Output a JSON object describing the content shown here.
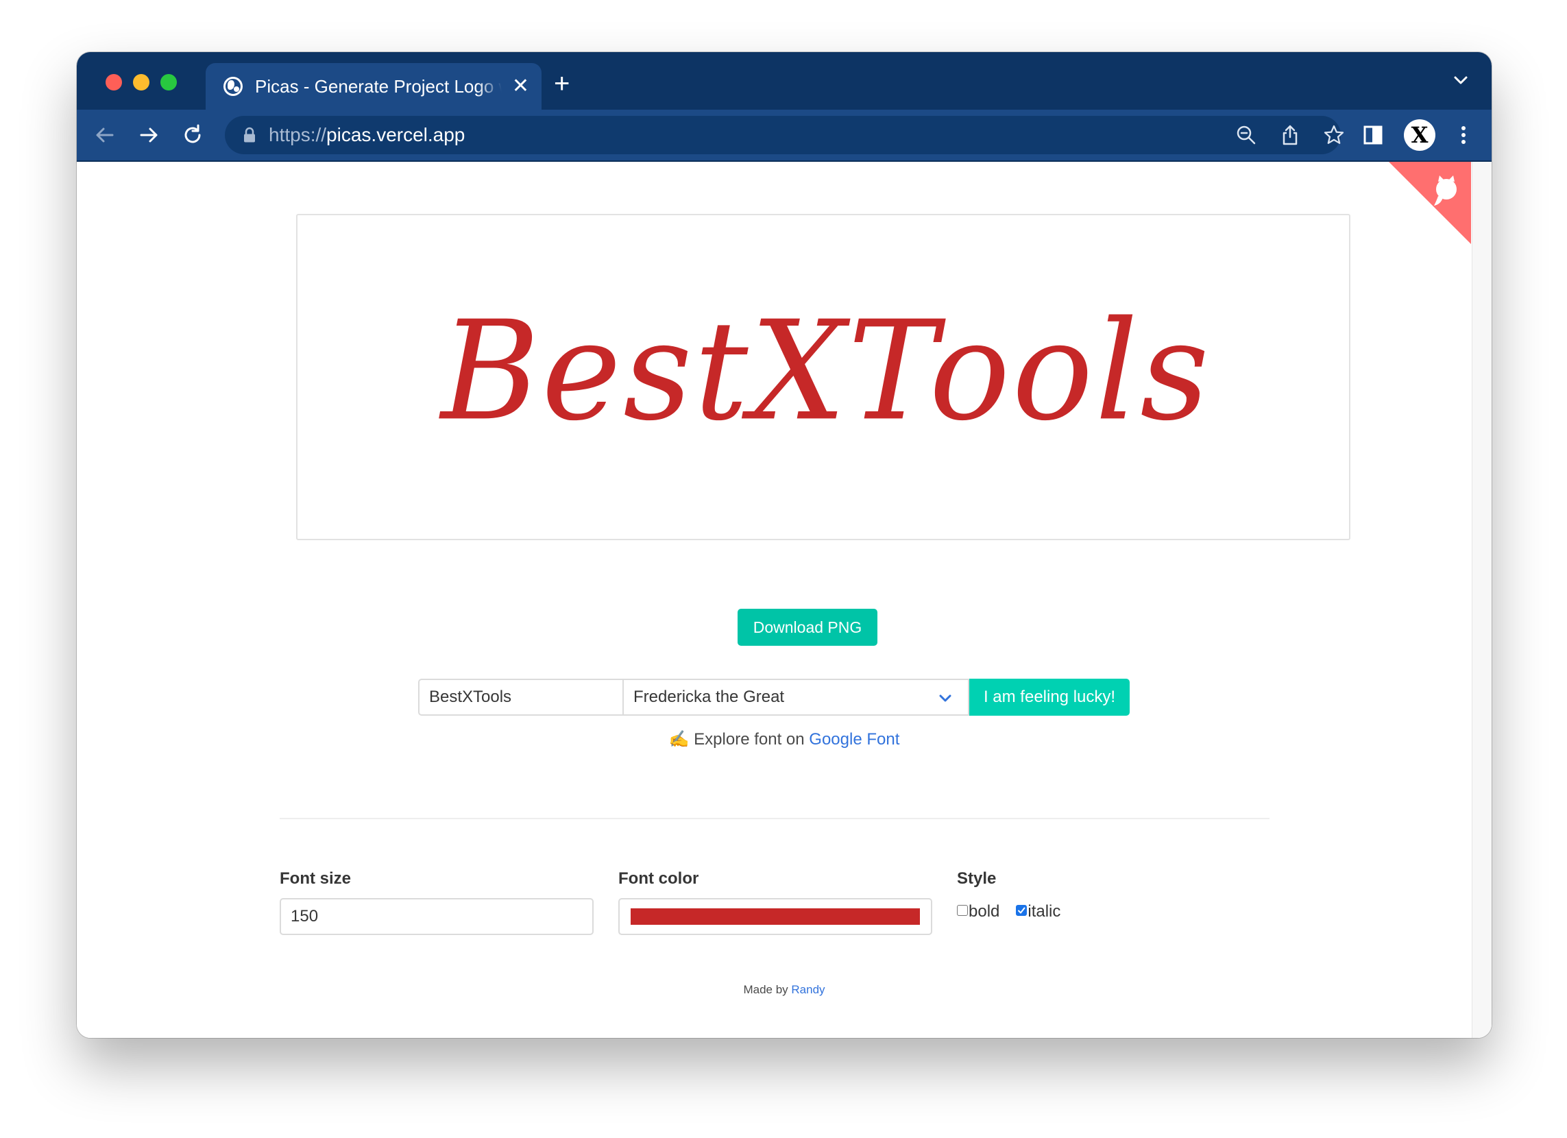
{
  "browser": {
    "tab_title": "Picas - Generate Project Logo with Google Fonts",
    "url_scheme": "https://",
    "url_host": "picas.vercel.app",
    "profile_letter": "X"
  },
  "preview": {
    "logo_text": "BestXTools",
    "logo_color": "#c62828"
  },
  "actions": {
    "download_label": "Download PNG",
    "lucky_label": "I am feeling lucky!"
  },
  "inputs": {
    "text_value": "BestXTools",
    "font_value": "Fredericka the Great"
  },
  "explore": {
    "prefix": "✍ Explore font on ",
    "link": "Google Font"
  },
  "settings": {
    "font_size_label": "Font size",
    "font_size_value": "150",
    "font_color_label": "Font color",
    "font_color_value": "#c62828",
    "style_label": "Style",
    "bold_label": "bold",
    "bold_checked": false,
    "italic_label": "italic",
    "italic_checked": true
  },
  "footer": {
    "prefix": "Made by ",
    "link": "Randy"
  },
  "colors": {
    "accent": "#00d1b2",
    "browser_frame": "#0d3464",
    "browser_toolbar": "#1c4a86",
    "link": "#3273dc",
    "corner": "#ff6f6f"
  },
  "icons": [
    "globe-icon",
    "close-icon",
    "new-tab-icon",
    "chevron-down-icon",
    "back-icon",
    "forward-icon",
    "reload-icon",
    "lock-icon",
    "zoom-icon",
    "share-icon",
    "bookmark-star-icon",
    "sidebar-icon",
    "menu-icon",
    "github-icon"
  ]
}
